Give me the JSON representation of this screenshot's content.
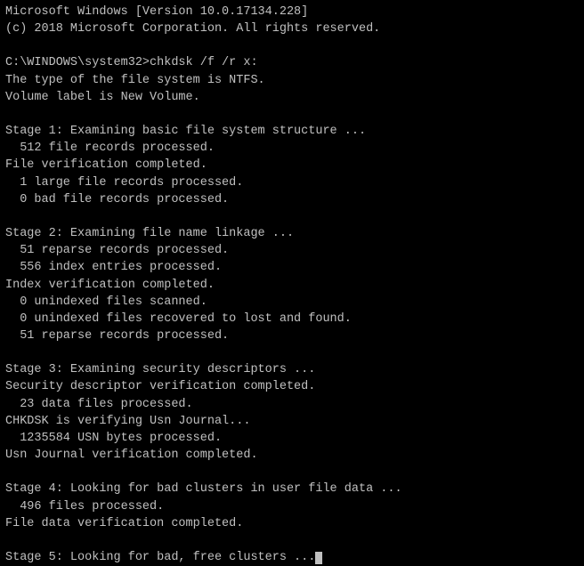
{
  "terminal": {
    "lines": [
      "Microsoft Windows [Version 10.0.17134.228]",
      "(c) 2018 Microsoft Corporation. All rights reserved.",
      "",
      "C:\\WINDOWS\\system32>chkdsk /f /r x:",
      "The type of the file system is NTFS.",
      "Volume label is New Volume.",
      "",
      "Stage 1: Examining basic file system structure ...",
      "  512 file records processed.",
      "File verification completed.",
      "  1 large file records processed.",
      "  0 bad file records processed.",
      "",
      "Stage 2: Examining file name linkage ...",
      "  51 reparse records processed.",
      "  556 index entries processed.",
      "Index verification completed.",
      "  0 unindexed files scanned.",
      "  0 unindexed files recovered to lost and found.",
      "  51 reparse records processed.",
      "",
      "Stage 3: Examining security descriptors ...",
      "Security descriptor verification completed.",
      "  23 data files processed.",
      "CHKDSK is verifying Usn Journal...",
      "  1235584 USN bytes processed.",
      "Usn Journal verification completed.",
      "",
      "Stage 4: Looking for bad clusters in user file data ...",
      "  496 files processed.",
      "File data verification completed.",
      "",
      "Stage 5: Looking for bad, free clusters ..."
    ]
  }
}
